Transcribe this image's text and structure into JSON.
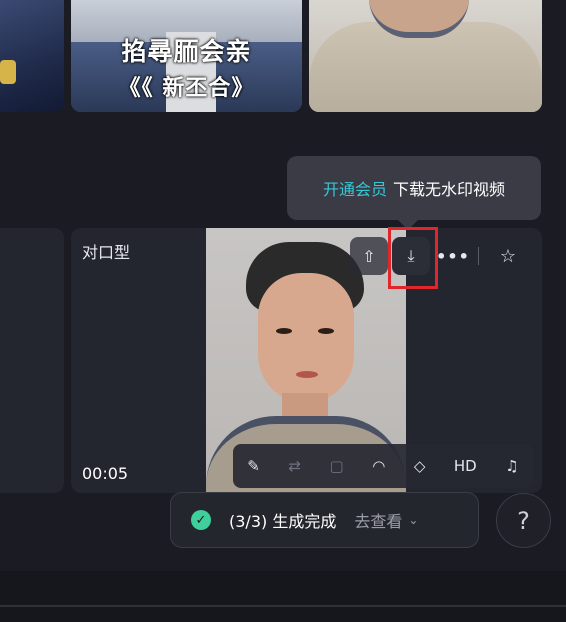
{
  "thumbnails": [
    {
      "overlay_line1": "",
      "overlay_line2": ""
    },
    {
      "overlay_line1": "掐尋胹会亲",
      "overlay_line2": "《《 新丕合》"
    },
    {
      "overlay_line1": "",
      "overlay_line2": ""
    }
  ],
  "tooltip": {
    "vip_link": "开通会员",
    "action_text": "下载无水印视频"
  },
  "card": {
    "label": "对口型",
    "duration": "00:05",
    "actions": [
      {
        "icon": "share-upload-icon",
        "glyph": "⇧"
      },
      {
        "icon": "download-icon",
        "glyph": "⤓"
      },
      {
        "icon": "more-icon",
        "glyph": "•••"
      },
      {
        "icon": "star-icon",
        "glyph": "☆"
      }
    ],
    "tools": [
      {
        "icon": "edit-pen-icon",
        "glyph": "✎",
        "enabled": true
      },
      {
        "icon": "loop-icon",
        "glyph": "⇄",
        "enabled": false
      },
      {
        "icon": "frame-icon",
        "glyph": "▢",
        "enabled": false
      },
      {
        "icon": "lip-sync-icon",
        "glyph": "◠",
        "enabled": true
      },
      {
        "icon": "interpolate-icon",
        "glyph": "◇",
        "enabled": true
      },
      {
        "icon": "hd-icon",
        "glyph": "HD",
        "enabled": true
      },
      {
        "icon": "music-note-icon",
        "glyph": "♫",
        "enabled": true
      }
    ]
  },
  "status": {
    "progress_text": "(3/3) 生成完成",
    "view_link": "去查看",
    "chevron": "⌄"
  },
  "help": {
    "label": "?"
  },
  "colors": {
    "accent_vip": "#35c8d6",
    "success": "#3fcf9a",
    "highlight_box": "#e0262a",
    "background": "#1b1c23"
  }
}
